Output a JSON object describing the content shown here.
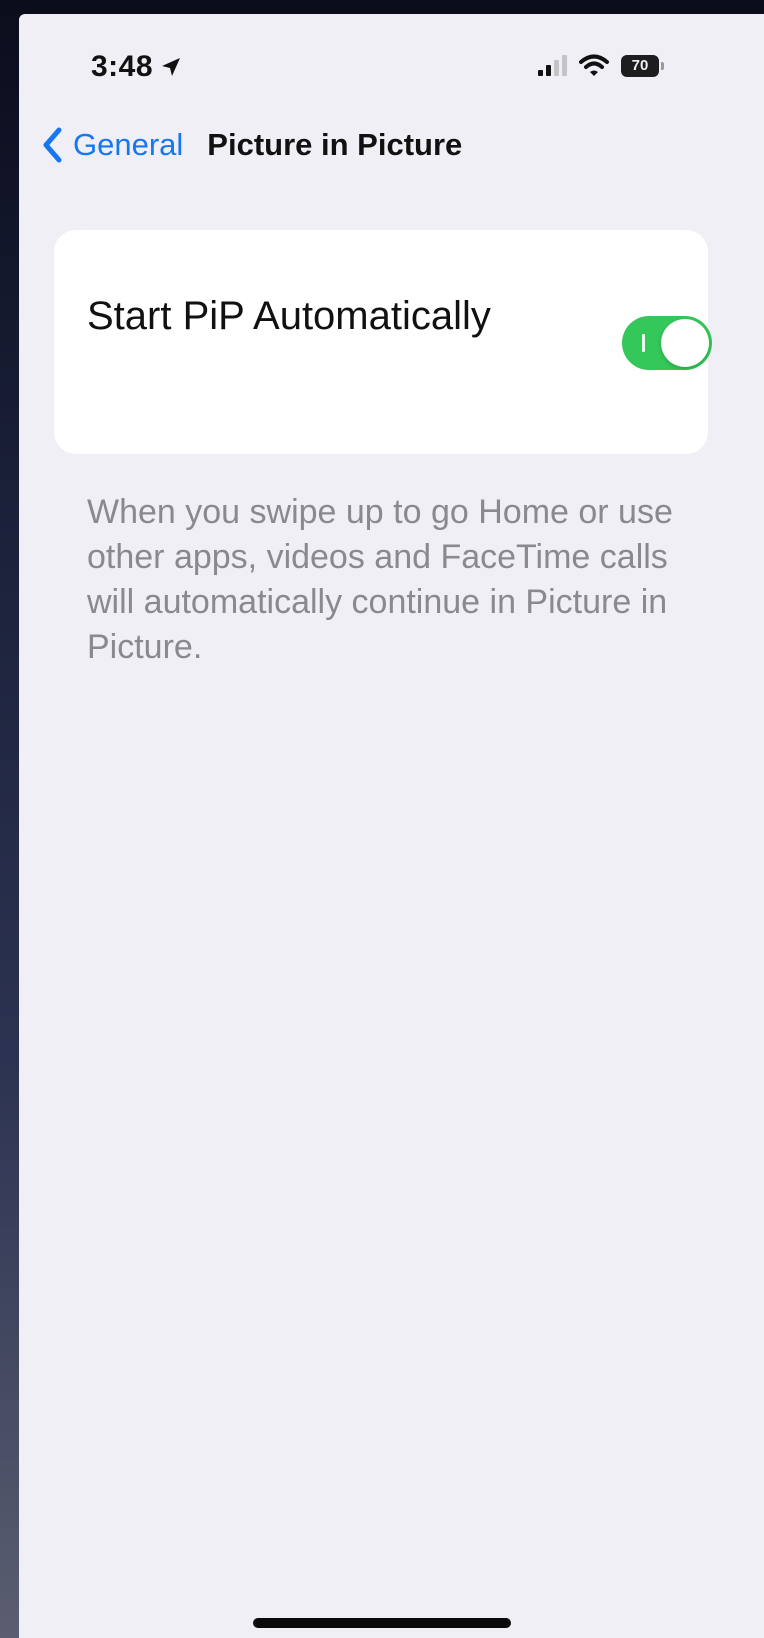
{
  "status_bar": {
    "time": "3:48",
    "location_icon": "location-arrow-icon",
    "signal_icon": "cellular-signal-icon",
    "wifi_icon": "wifi-icon",
    "battery_level": "70"
  },
  "nav": {
    "back_label": "General",
    "back_icon": "chevron-left-icon",
    "title": "Picture in Picture"
  },
  "settings": {
    "pip_row": {
      "label": "Start PiP Automatically",
      "toggle_on": true
    },
    "pip_footer": "When you swipe up to go Home or use other apps, videos and FaceTime calls will automatically continue in Picture in Picture."
  },
  "colors": {
    "accent_blue": "#1677f0",
    "toggle_green": "#34c759",
    "background": "#f0eff5"
  }
}
